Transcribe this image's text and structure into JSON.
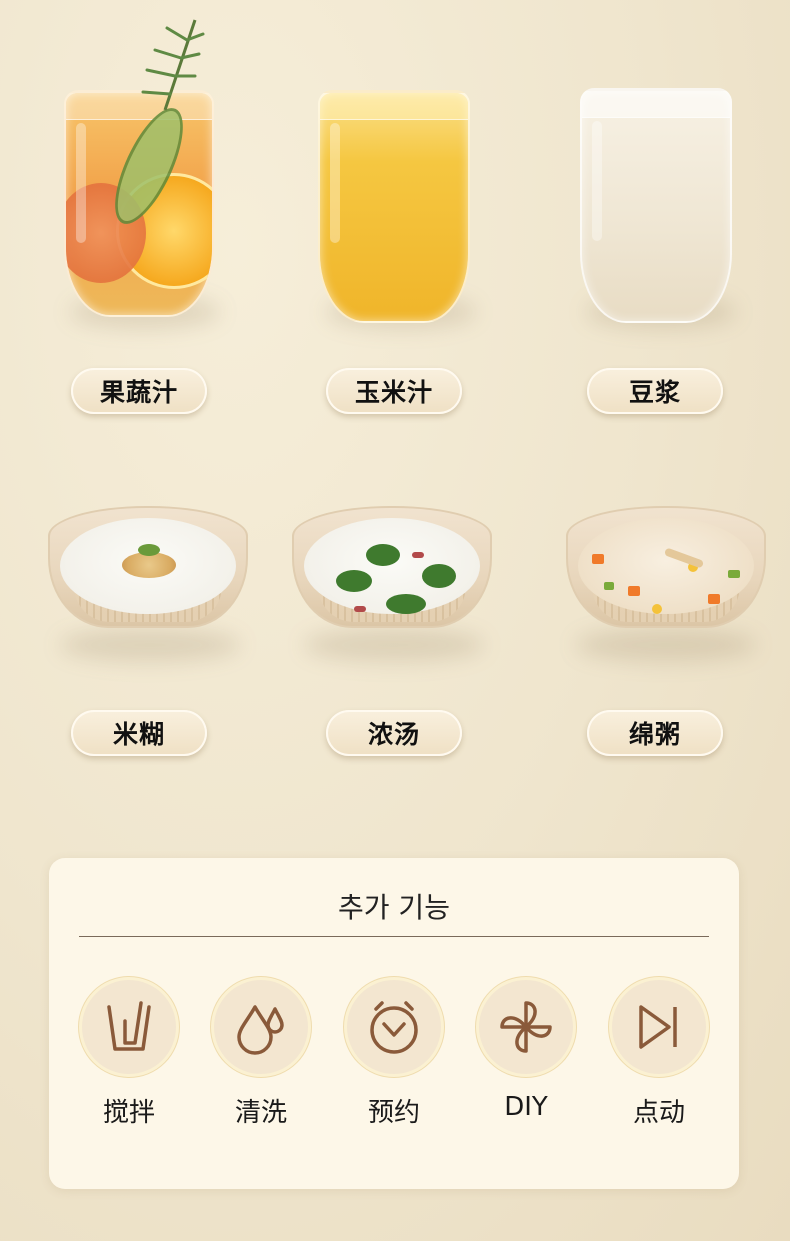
{
  "drinks": [
    {
      "label": "果蔬汁",
      "icon": "fruit-vegetable-juice-glass"
    },
    {
      "label": "玉米汁",
      "icon": "corn-juice-glass"
    },
    {
      "label": "豆浆",
      "icon": "soy-milk-glass"
    }
  ],
  "bowls": [
    {
      "label": "米糊",
      "icon": "rice-paste-bowl"
    },
    {
      "label": "浓汤",
      "icon": "thick-soup-bowl"
    },
    {
      "label": "绵粥",
      "icon": "congee-bowl"
    }
  ],
  "features": {
    "title": "추가 기능",
    "items": [
      {
        "label": "搅拌",
        "icon": "blend-icon"
      },
      {
        "label": "清洗",
        "icon": "water-drops-icon"
      },
      {
        "label": "预约",
        "icon": "alarm-clock-icon"
      },
      {
        "label": "DIY",
        "icon": "pinwheel-icon"
      },
      {
        "label": "点动",
        "icon": "play-pause-icon"
      }
    ]
  },
  "colors": {
    "background": "#efe4cc",
    "panel": "#fdf7e8",
    "icon_stroke": "#8a5a3a",
    "pill": "#f5ead3"
  }
}
